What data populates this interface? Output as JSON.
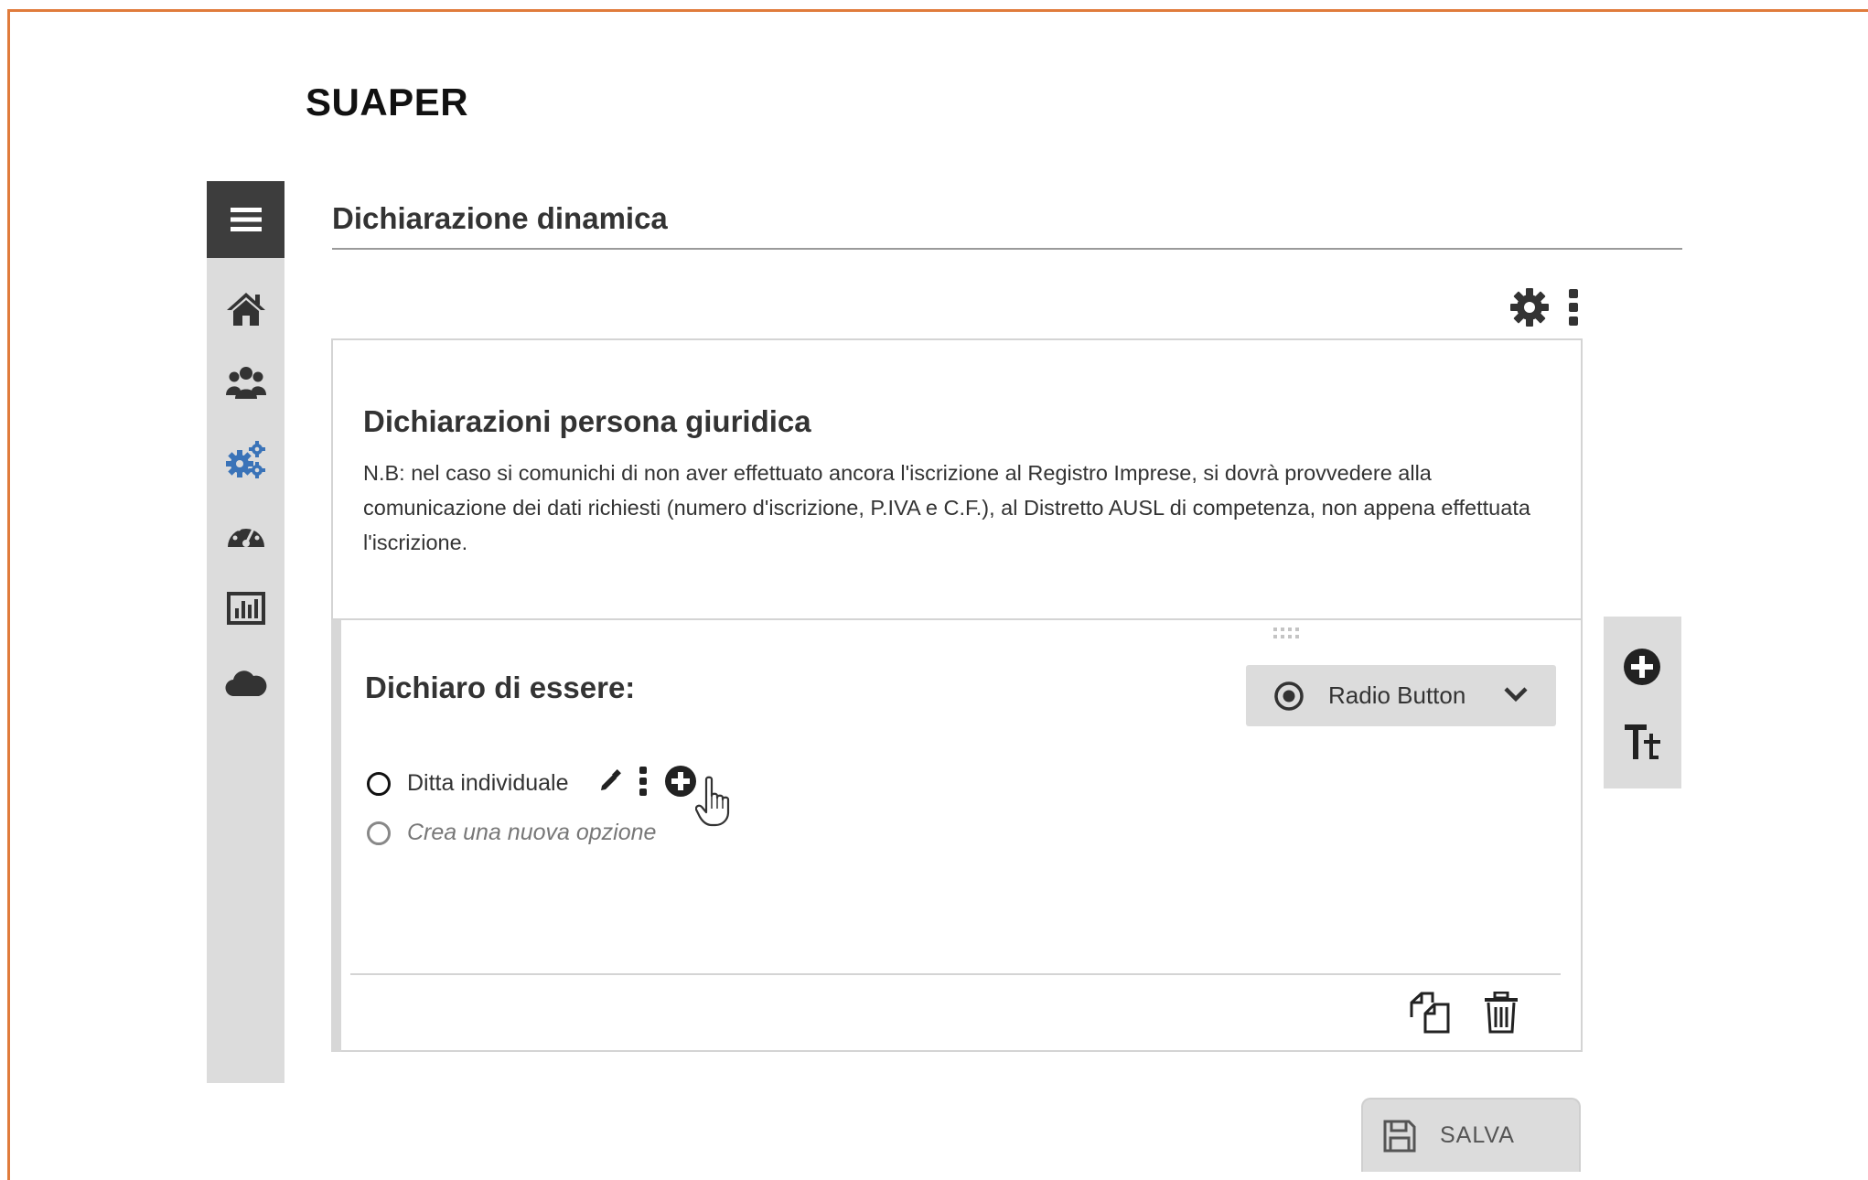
{
  "app": {
    "title": "SUAPER"
  },
  "sidebar": {
    "toggle_icon": "hamburger-menu-icon",
    "items": [
      {
        "icon": "home-icon"
      },
      {
        "icon": "users-icon"
      },
      {
        "icon": "gears-icon",
        "active": true,
        "color": "#3a73b8"
      },
      {
        "icon": "dashboard-icon"
      },
      {
        "icon": "bar-chart-icon"
      },
      {
        "icon": "cloud-icon"
      }
    ]
  },
  "page": {
    "heading": "Dichiarazione dinamica"
  },
  "toolbar": {
    "settings_icon": "gear-icon",
    "more_icon": "kebab-icon"
  },
  "section": {
    "title": "Dichiarazioni persona giuridica",
    "description": "N.B: nel caso si comunichi di non aver effettuato ancora l'iscrizione al Registro Imprese, si dovrà provvedere alla comunicazione dei dati richiesti (numero d'iscrizione, P.IVA e C.F.), al Distretto AUSL di competenza, non appena effettuata l'iscrizione."
  },
  "field": {
    "title": "Dichiaro di essere:",
    "type_select": {
      "label": "Radio Button",
      "icon": "radio-target-icon"
    },
    "options": [
      {
        "label": "Ditta individuale"
      }
    ],
    "new_option_placeholder": "Crea una nuova opzione"
  },
  "side_toolbox": {
    "add_icon": "plus-circle-icon",
    "text_icon": "text-size-icon"
  },
  "footer": {
    "duplicate_icon": "copy-icon",
    "delete_icon": "trash-icon"
  },
  "save": {
    "label": "SALVA"
  },
  "colors": {
    "accent": "#e07b3c",
    "sidebar_bg": "#dcdcdc",
    "toggle_bg": "#3d3d3d",
    "active_icon": "#3a73b8"
  }
}
